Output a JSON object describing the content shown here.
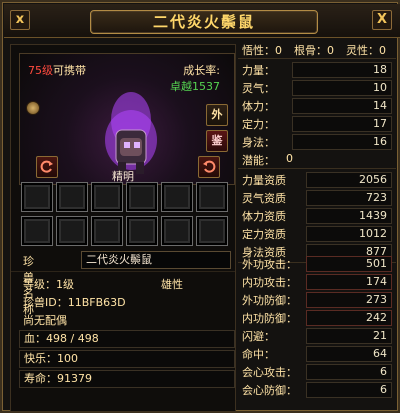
{
  "window": {
    "title": "二代炎火鬃鼠",
    "left_icon": "x",
    "close_icon": "X"
  },
  "pet_view": {
    "level_num": "75级",
    "level_suffix": "可携带",
    "growth_label": "成长率:",
    "growth_value": "卓越1537",
    "name_tag": "精明",
    "buttons": {
      "out": "外",
      "appraise": "鉴"
    }
  },
  "name_field": {
    "label": "珍兽名称",
    "value": "二代炎火鬃鼠"
  },
  "info": {
    "level": "等级：1级",
    "gender": "雄性",
    "id": "珍兽ID：11BFB63D",
    "mate": "尚无配偶"
  },
  "bars": {
    "hp": "血：498 / 498",
    "joy": "快乐：100",
    "life": "寿命：91379"
  },
  "attributes": {
    "wuxing": "悟性：0",
    "gengu": "根骨：0",
    "lingxing": "灵性：0",
    "stats": [
      {
        "label": "力量：",
        "value": "18"
      },
      {
        "label": "灵气：",
        "value": "10"
      },
      {
        "label": "体力：",
        "value": "14"
      },
      {
        "label": "定力：",
        "value": "17"
      },
      {
        "label": "身法：",
        "value": "16"
      }
    ],
    "potential_label": "潜能：",
    "potential_value": "0",
    "aptitudes": [
      {
        "label": "力量资质",
        "value": "2056"
      },
      {
        "label": "灵气资质",
        "value": "723"
      },
      {
        "label": "体力资质",
        "value": "1439"
      },
      {
        "label": "定力资质",
        "value": "1012"
      },
      {
        "label": "身法资质",
        "value": "877"
      }
    ],
    "combat": [
      {
        "label": "外功攻击：",
        "value": "501"
      },
      {
        "label": "内功攻击：",
        "value": "174"
      },
      {
        "label": "外功防御：",
        "value": "273"
      },
      {
        "label": "内功防御：",
        "value": "242"
      },
      {
        "label": "闪避：",
        "value": "21"
      },
      {
        "label": "命中：",
        "value": "64"
      },
      {
        "label": "会心攻击：",
        "value": "6"
      },
      {
        "label": "会心防御：",
        "value": "6"
      }
    ]
  },
  "colors": {
    "accent_gold": "#ffd76a",
    "level_red": "#ff4b3e",
    "growth_green": "#55d451"
  }
}
